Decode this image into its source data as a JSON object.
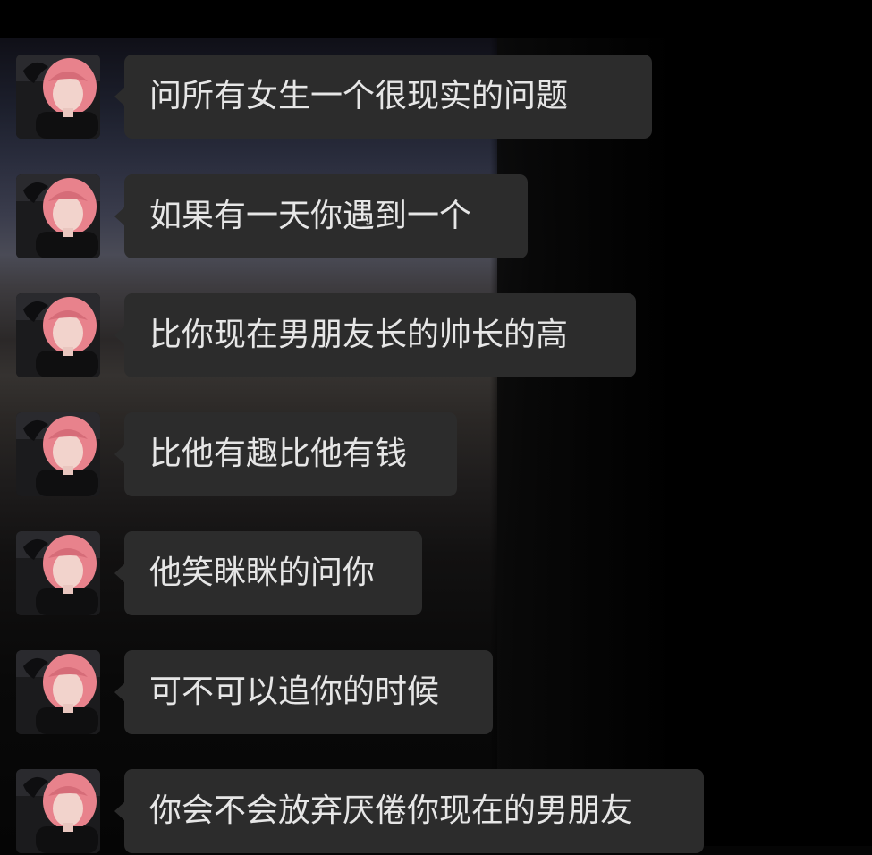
{
  "chat": {
    "messages": [
      {
        "sender": "contact",
        "text": "问所有女生一个很现实的问题"
      },
      {
        "sender": "contact",
        "text": "如果有一天你遇到一个"
      },
      {
        "sender": "contact",
        "text": "比你现在男朋友长的帅长的高"
      },
      {
        "sender": "contact",
        "text": "比他有趣比他有钱"
      },
      {
        "sender": "contact",
        "text": "他笑眯眯的问你"
      },
      {
        "sender": "contact",
        "text": "可不可以追你的时候"
      },
      {
        "sender": "contact",
        "text": "你会不会放弃厌倦你现在的男朋友"
      }
    ]
  },
  "colors": {
    "bubble": "#2c2c2c",
    "text": "#e6e6e6",
    "hair": "#e8828c",
    "background": "#050505"
  },
  "icons": {
    "avatar": "avatar-photo"
  }
}
